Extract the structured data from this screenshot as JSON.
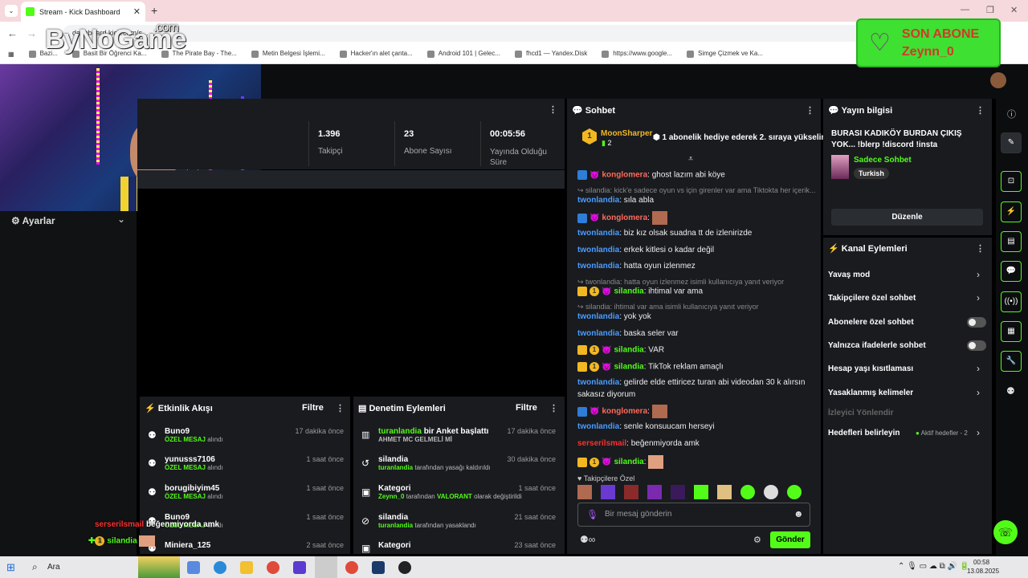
{
  "browser": {
    "tab_title": "Stream - Kick Dashboard",
    "url": "dashboard.kick.com/s...",
    "bookmarks": [
      "Bazi...",
      "Basit Bir Öğrenci Ka...",
      "The Pirate Bay - The...",
      "Metin Belgesi İşlemi...",
      "Hacker'ın alet çanta...",
      "Android 101 | Gelec...",
      "fhcd1 — Yandex.Disk",
      "https://www.google...",
      "Simge Çizmek ve Ka..."
    ]
  },
  "overlay": {
    "logo": "ByNoGame",
    "logo_suffix": ".com",
    "sub_label": "SON ABONE",
    "sub_name": "Zeynn_0",
    "chat_line1_user": "serserilsmail",
    "chat_line1_text": "beğenmiyorda amk",
    "chat_line2_user": "silandia"
  },
  "sidebar": {
    "settings_label": "Ayarlar"
  },
  "stats": [
    {
      "value": "1.396",
      "label": "Takipçi"
    },
    {
      "value": "23",
      "label": "Abone Sayısı"
    },
    {
      "value": "00:05:56",
      "label": "Yayında Olduğu Süre"
    }
  ],
  "activity": {
    "title": "Etkinlik Akışı",
    "filter": "Filtre",
    "items": [
      {
        "name": "Buno9",
        "sub": "ÖZEL MESAJ",
        "suffix": "alındı",
        "time": "17 dakika önce"
      },
      {
        "name": "yunusss7106",
        "sub": "ÖZEL MESAJ",
        "suffix": "alındı",
        "time": "1 saat önce"
      },
      {
        "name": "borugibiyim45",
        "sub": "ÖZEL MESAJ",
        "suffix": "alındı",
        "time": "1 saat önce"
      },
      {
        "name": "Buno9",
        "sub": "ÖZEL MESAJ",
        "suffix": "alındı",
        "time": "1 saat önce"
      },
      {
        "name": "Miniera_125",
        "sub": "",
        "suffix": "",
        "time": "2 saat önce"
      }
    ]
  },
  "moderation": {
    "title": "Denetim Eylemleri",
    "filter": "Filtre",
    "items": [
      {
        "title_user": "turanlandia",
        "title_text": "bir Anket başlattı",
        "sub": "AHMET MC GELMELİ Mİ",
        "time": "17 dakika önce"
      },
      {
        "title_user": "",
        "title_text": "silandia",
        "sub_user": "turanlandia",
        "sub": "tarafından yasağı kaldırıldı",
        "time": "30 dakika önce"
      },
      {
        "title_user": "",
        "title_text": "Kategori",
        "sub_user": "Zeynn_0",
        "sub": "tarafından",
        "sub_tag": "VALORANT",
        "sub_end": "olarak değiştirildi",
        "time": "1 saat önce"
      },
      {
        "title_user": "",
        "title_text": "silandia",
        "sub_user": "turanlandia",
        "sub": "tarafından yasaklandı",
        "time": "21 saat önce"
      },
      {
        "title_user": "",
        "title_text": "Kategori",
        "sub": "",
        "time": "23 saat önce"
      }
    ]
  },
  "chat": {
    "title": "Sohbet",
    "pinned_user": "MoonSharper",
    "pinned_count": "2",
    "pinned_text": "1 abonelik hediye ederek 2. sıraya yükselin",
    "messages": [
      {
        "user": "konglomera",
        "text": "ghost lazım abi köye"
      },
      {
        "reply": "silandia: kick'e sadece oyun vs için girenler var ama Tiktokta her içerik..."
      },
      {
        "user": "twonlandia",
        "text": "sıla abla"
      },
      {
        "user": "konglomera",
        "text": ""
      },
      {
        "user": "twonlandia",
        "text": "biz kız olsak suadna tt de izlenirizde"
      },
      {
        "user": "twonlandia",
        "text": "erkek kitlesi o kadar değil"
      },
      {
        "user": "twonlandia",
        "text": "hatta oyun izlenmez"
      },
      {
        "reply": "twonlandia: hatta oyun izlenmez isimli kullanıcıya yanıt veriyor"
      },
      {
        "user": "silandia",
        "text": "ihtimal var ama"
      },
      {
        "reply": "silandia: ihtimal var ama isimli kullanıcıya yanıt veriyor"
      },
      {
        "user": "twonlandia",
        "text": "yok yok"
      },
      {
        "user": "twonlandia",
        "text": "baska seler var"
      },
      {
        "user": "silandia",
        "text": "VAR"
      },
      {
        "user": "silandia",
        "text": "TikTok reklam amaçlı"
      },
      {
        "user": "twonlandia",
        "text": "gelirde elde ettiricez turan abi videodan 30 k alırsın"
      },
      {
        "cont": "sakasız diyorum"
      },
      {
        "user": "konglomera",
        "text": ""
      },
      {
        "user": "twonlandia",
        "text": "senle konsuucam herseyi"
      },
      {
        "user": "serserilsmail",
        "text": "beğenmiyorda amk"
      },
      {
        "user": "silandia",
        "text": ""
      }
    ],
    "followers_label": "Takipçilere Özel",
    "input_placeholder": "Bir mesaj gönderin",
    "send_label": "Gönder"
  },
  "stream_info": {
    "title": "Yayın bilgisi",
    "stream_title": "BURASI KADIKÖY BURDAN ÇIKIŞ YOK... !blerp !discord !insta",
    "category": "Sadece Sohbet",
    "tag": "Turkish",
    "edit_label": "Düzenle"
  },
  "channel_actions": {
    "title": "Kanal Eylemleri",
    "items": [
      {
        "label": "Yavaş mod",
        "kind": "chevron"
      },
      {
        "label": "Takipçilere özel sohbet",
        "kind": "chevron"
      },
      {
        "label": "Abonelere özel sohbet",
        "kind": "toggle"
      },
      {
        "label": "Yalnızca ifadelerle sohbet",
        "kind": "toggle"
      },
      {
        "label": "Hesap yaşı kısıtlaması",
        "kind": "chevron"
      },
      {
        "label": "Yasaklanmış kelimeler",
        "kind": "chevron"
      },
      {
        "label": "İzleyici Yönlendir",
        "kind": "disabled"
      },
      {
        "label": "Hedefleri belirleyin",
        "kind": "goal",
        "extra": "Aktif hedefler - 2"
      }
    ]
  },
  "taskbar": {
    "search": "Ara",
    "time": "00:58",
    "date": "13.08.2025"
  },
  "colors": {
    "accent": "#53fc18",
    "panel": "#191b1f",
    "bg": "#0b0d0f"
  }
}
